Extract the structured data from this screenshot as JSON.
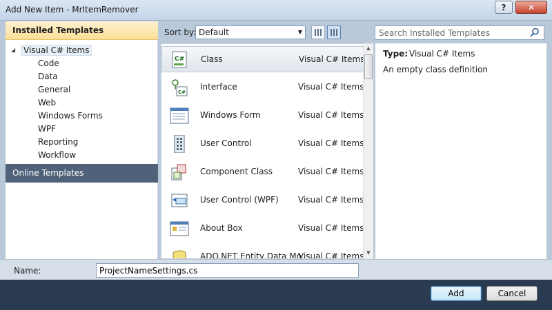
{
  "window": {
    "title": "Add New Item - MrItemRemover",
    "help_label": "?",
    "close_label": "✕"
  },
  "sidebar": {
    "installed_header": "Installed Templates",
    "tree_root": "Visual C# Items",
    "items": [
      {
        "label": "Code"
      },
      {
        "label": "Data"
      },
      {
        "label": "General"
      },
      {
        "label": "Web"
      },
      {
        "label": "Windows Forms"
      },
      {
        "label": "WPF"
      },
      {
        "label": "Reporting"
      },
      {
        "label": "Workflow"
      }
    ],
    "online_templates": "Online Templates"
  },
  "toolbar": {
    "sort_label": "Sort by:",
    "sort_value": "Default"
  },
  "search": {
    "placeholder": "Search Installed Templates"
  },
  "templates": [
    {
      "name": "Class",
      "type": "Visual C# Items",
      "icon": "class-icon",
      "selected": true
    },
    {
      "name": "Interface",
      "type": "Visual C# Items",
      "icon": "interface-icon"
    },
    {
      "name": "Windows Form",
      "type": "Visual C# Items",
      "icon": "windows-form-icon"
    },
    {
      "name": "User Control",
      "type": "Visual C# Items",
      "icon": "user-control-icon"
    },
    {
      "name": "Component Class",
      "type": "Visual C# Items",
      "icon": "component-class-icon"
    },
    {
      "name": "User Control (WPF)",
      "type": "Visual C# Items",
      "icon": "wpf-user-control-icon"
    },
    {
      "name": "About Box",
      "type": "Visual C# Items",
      "icon": "about-box-icon"
    },
    {
      "name": "ADO.NET Entity Data Mo",
      "type": "Visual C# Items",
      "icon": "entity-data-model-icon"
    }
  ],
  "details": {
    "type_label": "Type:",
    "type_value": "Visual C# Items",
    "description": "An empty class definition"
  },
  "name_field": {
    "label": "Name:",
    "value": "ProjectNameSettings.cs"
  },
  "buttons": {
    "add": "Add",
    "cancel": "Cancel"
  }
}
